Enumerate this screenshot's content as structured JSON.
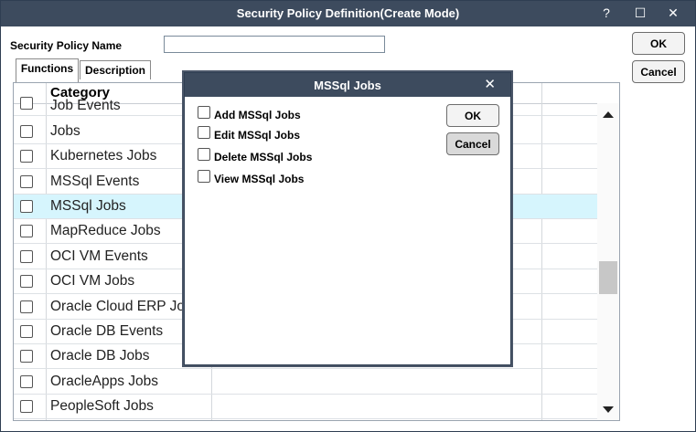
{
  "window": {
    "title": "Security Policy Definition(Create Mode)",
    "help_glyph": "?",
    "maximize_glyph": "☐",
    "close_glyph": "✕"
  },
  "form": {
    "name_label": "Security Policy Name",
    "name_value": "",
    "ok_label": "OK",
    "cancel_label": "Cancel"
  },
  "tabs": [
    {
      "label": "Functions",
      "active": true
    },
    {
      "label": "Description",
      "active": false
    }
  ],
  "grid": {
    "header": "Category",
    "rows": [
      {
        "label": "Job Events",
        "selected": false
      },
      {
        "label": "Jobs",
        "selected": false
      },
      {
        "label": "Kubernetes Jobs",
        "selected": false
      },
      {
        "label": "MSSql Events",
        "selected": false
      },
      {
        "label": "MSSql Jobs",
        "selected": true
      },
      {
        "label": "MapReduce Jobs",
        "selected": false
      },
      {
        "label": "OCI VM Events",
        "selected": false
      },
      {
        "label": "OCI VM Jobs",
        "selected": false
      },
      {
        "label": "Oracle Cloud ERP Jobs",
        "selected": false
      },
      {
        "label": "Oracle DB Events",
        "selected": false
      },
      {
        "label": "Oracle DB Jobs",
        "selected": false
      },
      {
        "label": "OracleApps Jobs",
        "selected": false
      },
      {
        "label": "PeopleSoft Jobs",
        "selected": false
      }
    ]
  },
  "modal": {
    "title": "MSSql Jobs",
    "close_glyph": "✕",
    "options": [
      {
        "label": "Add MSSql Jobs",
        "checked": false
      },
      {
        "label": "Edit MSSql Jobs",
        "checked": false
      },
      {
        "label": "Delete MSSql Jobs",
        "checked": false
      },
      {
        "label": "View MSSql Jobs",
        "checked": false
      }
    ],
    "ok_label": "OK",
    "cancel_label": "Cancel"
  },
  "colors": {
    "titlebar": "#3d4b5e",
    "selected_row": "#d6f5fd",
    "cancel_button_modal": "#d9d9d9"
  }
}
